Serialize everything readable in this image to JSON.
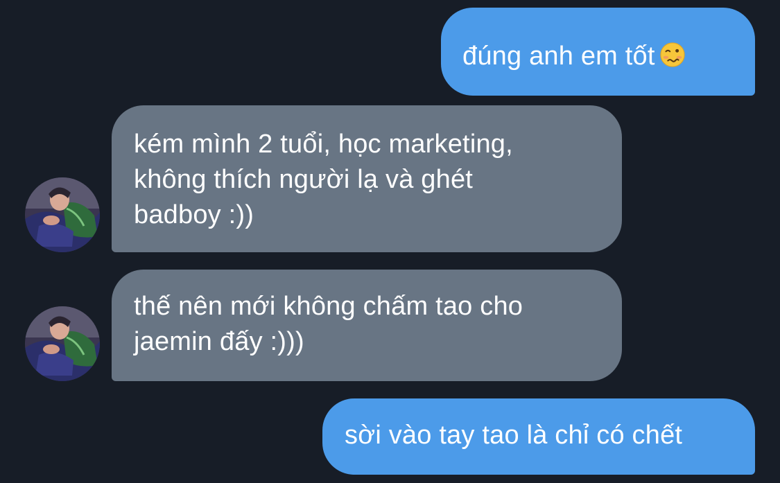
{
  "messages": [
    {
      "sender": "self",
      "lines": [
        "đúng anh em tốt"
      ],
      "emoji": "woozy-face-icon"
    },
    {
      "sender": "contact",
      "lines": [
        "kém mình 2 tuổi, học marketing,",
        "không thích người lạ và ghét",
        "badboy :))"
      ]
    },
    {
      "sender": "contact",
      "lines": [
        "thế nên mới không chấm tao cho",
        "jaemin đấy :)))"
      ]
    },
    {
      "sender": "self",
      "lines": [
        "sời vào tay tao là chỉ có chết"
      ]
    }
  ],
  "colors": {
    "background": "#171d27",
    "outgoing_bubble": "#4c9be9",
    "incoming_bubble": "#687584",
    "text": "#ffffff"
  }
}
